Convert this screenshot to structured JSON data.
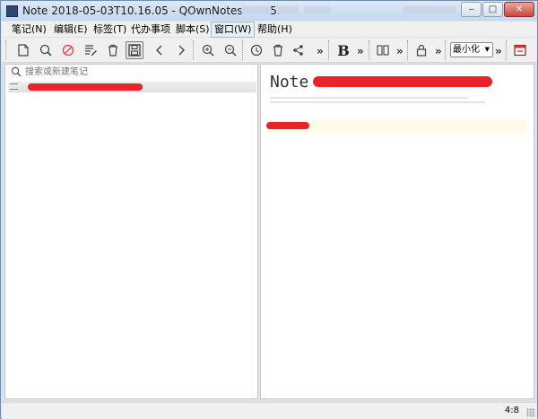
{
  "window": {
    "title": "Note 2018-05-03T10.16.05 - QOwnNotes 18.05.0",
    "controls": {
      "minimize": "‒",
      "maximize": "□",
      "close": "✕"
    }
  },
  "menu": {
    "items": [
      "笔记(N)",
      "编辑(E)",
      "标签(T)",
      "代办事项",
      "脚本(S)",
      "窗口(W)",
      "帮助(H)"
    ],
    "active": "窗口(W)"
  },
  "toolbar": {
    "chevron": "»",
    "bold_label": "B",
    "workspace_value": "最小化",
    "icons": [
      "new-note-icon",
      "find-icon",
      "cancel-icon",
      "edit-note-icon",
      "delete-note-icon",
      "save-icon",
      "back-icon",
      "forward-icon",
      "zoom-in-icon",
      "zoom-out-icon",
      "history-icon",
      "trash-icon",
      "share-icon",
      "bold-icon",
      "split-view-icon",
      "lock-icon",
      "workspace-select",
      "panel-icon"
    ]
  },
  "search": {
    "placeholder": "搜索或新建笔记"
  },
  "preview": {
    "title_prefix": "Note"
  },
  "status": {
    "cursor_position": "4:8"
  },
  "colors": {
    "redaction": "#e8232a",
    "highlight": "#fffbe9",
    "frame": "#d6e3f1"
  }
}
